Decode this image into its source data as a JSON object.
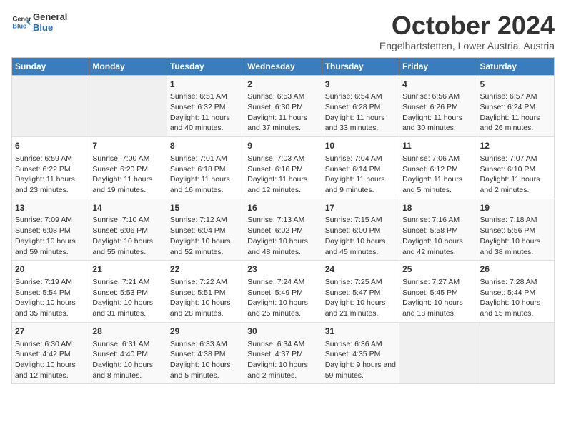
{
  "header": {
    "logo_general": "General",
    "logo_blue": "Blue",
    "month": "October 2024",
    "location": "Engelhartstetten, Lower Austria, Austria"
  },
  "days_of_week": [
    "Sunday",
    "Monday",
    "Tuesday",
    "Wednesday",
    "Thursday",
    "Friday",
    "Saturday"
  ],
  "weeks": [
    [
      {
        "day": "",
        "info": ""
      },
      {
        "day": "",
        "info": ""
      },
      {
        "day": "1",
        "info": "Sunrise: 6:51 AM\nSunset: 6:32 PM\nDaylight: 11 hours and 40 minutes."
      },
      {
        "day": "2",
        "info": "Sunrise: 6:53 AM\nSunset: 6:30 PM\nDaylight: 11 hours and 37 minutes."
      },
      {
        "day": "3",
        "info": "Sunrise: 6:54 AM\nSunset: 6:28 PM\nDaylight: 11 hours and 33 minutes."
      },
      {
        "day": "4",
        "info": "Sunrise: 6:56 AM\nSunset: 6:26 PM\nDaylight: 11 hours and 30 minutes."
      },
      {
        "day": "5",
        "info": "Sunrise: 6:57 AM\nSunset: 6:24 PM\nDaylight: 11 hours and 26 minutes."
      }
    ],
    [
      {
        "day": "6",
        "info": "Sunrise: 6:59 AM\nSunset: 6:22 PM\nDaylight: 11 hours and 23 minutes."
      },
      {
        "day": "7",
        "info": "Sunrise: 7:00 AM\nSunset: 6:20 PM\nDaylight: 11 hours and 19 minutes."
      },
      {
        "day": "8",
        "info": "Sunrise: 7:01 AM\nSunset: 6:18 PM\nDaylight: 11 hours and 16 minutes."
      },
      {
        "day": "9",
        "info": "Sunrise: 7:03 AM\nSunset: 6:16 PM\nDaylight: 11 hours and 12 minutes."
      },
      {
        "day": "10",
        "info": "Sunrise: 7:04 AM\nSunset: 6:14 PM\nDaylight: 11 hours and 9 minutes."
      },
      {
        "day": "11",
        "info": "Sunrise: 7:06 AM\nSunset: 6:12 PM\nDaylight: 11 hours and 5 minutes."
      },
      {
        "day": "12",
        "info": "Sunrise: 7:07 AM\nSunset: 6:10 PM\nDaylight: 11 hours and 2 minutes."
      }
    ],
    [
      {
        "day": "13",
        "info": "Sunrise: 7:09 AM\nSunset: 6:08 PM\nDaylight: 10 hours and 59 minutes."
      },
      {
        "day": "14",
        "info": "Sunrise: 7:10 AM\nSunset: 6:06 PM\nDaylight: 10 hours and 55 minutes."
      },
      {
        "day": "15",
        "info": "Sunrise: 7:12 AM\nSunset: 6:04 PM\nDaylight: 10 hours and 52 minutes."
      },
      {
        "day": "16",
        "info": "Sunrise: 7:13 AM\nSunset: 6:02 PM\nDaylight: 10 hours and 48 minutes."
      },
      {
        "day": "17",
        "info": "Sunrise: 7:15 AM\nSunset: 6:00 PM\nDaylight: 10 hours and 45 minutes."
      },
      {
        "day": "18",
        "info": "Sunrise: 7:16 AM\nSunset: 5:58 PM\nDaylight: 10 hours and 42 minutes."
      },
      {
        "day": "19",
        "info": "Sunrise: 7:18 AM\nSunset: 5:56 PM\nDaylight: 10 hours and 38 minutes."
      }
    ],
    [
      {
        "day": "20",
        "info": "Sunrise: 7:19 AM\nSunset: 5:54 PM\nDaylight: 10 hours and 35 minutes."
      },
      {
        "day": "21",
        "info": "Sunrise: 7:21 AM\nSunset: 5:53 PM\nDaylight: 10 hours and 31 minutes."
      },
      {
        "day": "22",
        "info": "Sunrise: 7:22 AM\nSunset: 5:51 PM\nDaylight: 10 hours and 28 minutes."
      },
      {
        "day": "23",
        "info": "Sunrise: 7:24 AM\nSunset: 5:49 PM\nDaylight: 10 hours and 25 minutes."
      },
      {
        "day": "24",
        "info": "Sunrise: 7:25 AM\nSunset: 5:47 PM\nDaylight: 10 hours and 21 minutes."
      },
      {
        "day": "25",
        "info": "Sunrise: 7:27 AM\nSunset: 5:45 PM\nDaylight: 10 hours and 18 minutes."
      },
      {
        "day": "26",
        "info": "Sunrise: 7:28 AM\nSunset: 5:44 PM\nDaylight: 10 hours and 15 minutes."
      }
    ],
    [
      {
        "day": "27",
        "info": "Sunrise: 6:30 AM\nSunset: 4:42 PM\nDaylight: 10 hours and 12 minutes."
      },
      {
        "day": "28",
        "info": "Sunrise: 6:31 AM\nSunset: 4:40 PM\nDaylight: 10 hours and 8 minutes."
      },
      {
        "day": "29",
        "info": "Sunrise: 6:33 AM\nSunset: 4:38 PM\nDaylight: 10 hours and 5 minutes."
      },
      {
        "day": "30",
        "info": "Sunrise: 6:34 AM\nSunset: 4:37 PM\nDaylight: 10 hours and 2 minutes."
      },
      {
        "day": "31",
        "info": "Sunrise: 6:36 AM\nSunset: 4:35 PM\nDaylight: 9 hours and 59 minutes."
      },
      {
        "day": "",
        "info": ""
      },
      {
        "day": "",
        "info": ""
      }
    ]
  ]
}
